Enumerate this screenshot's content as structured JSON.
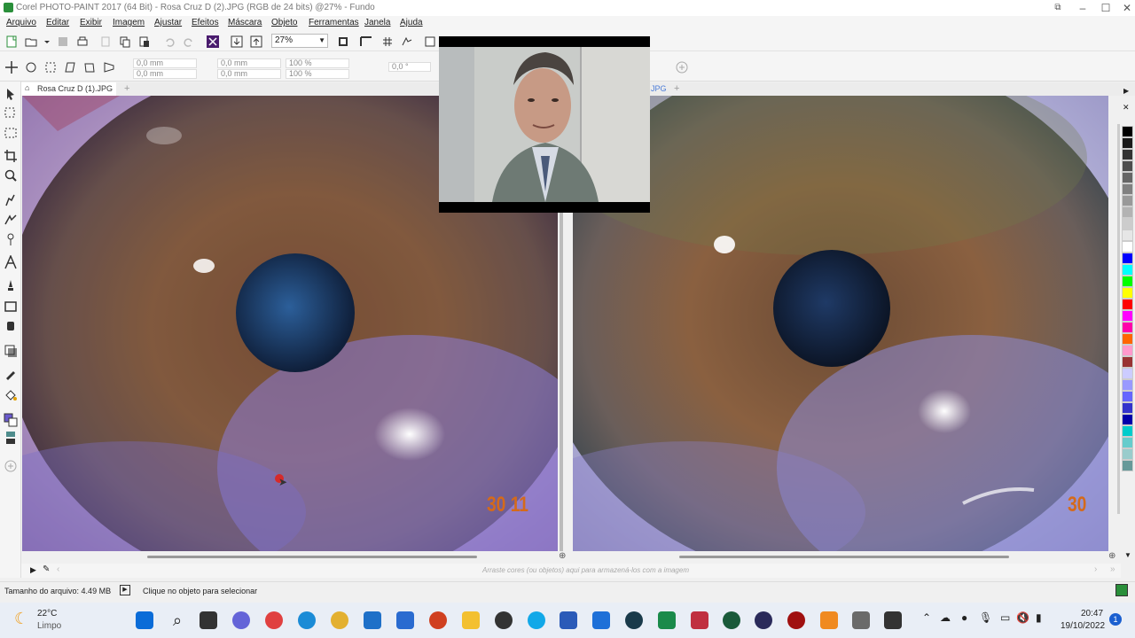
{
  "window": {
    "title": "Corel PHOTO-PAINT 2017 (64 Bit) - Rosa Cruz D (2).JPG (RGB de 24 bits) @27% - Fundo",
    "controls": [
      "–",
      "☐",
      "✕"
    ]
  },
  "menu": [
    "Arquivo",
    "Editar",
    "Exibir",
    "Imagem",
    "Ajustar",
    "Efeitos",
    "Máscara",
    "Objeto",
    "Ferramentas",
    "Janela",
    "Ajuda"
  ],
  "toolbar": {
    "zoom": "27%"
  },
  "propbar": {
    "pos_x": "0,0 mm",
    "pos_y": "0,0 mm",
    "size_w": "0,0 mm",
    "size_h": "0,0 mm",
    "scale_w": "100 %",
    "scale_h": "100 %",
    "angle": "0,0 °"
  },
  "tabs": {
    "left": "Rosa Cruz D (1).JPG",
    "right_partial": "JPG"
  },
  "canvas": {
    "left_date": "30  11",
    "right_date": "30"
  },
  "palette_hint": "Arraste cores (ou objetos) aqui para armazená-los com a imagem",
  "status": {
    "file_size": "Tamanho do arquivo: 4.49 MB",
    "hint": "Clique no objeto para selecionar"
  },
  "taskbar": {
    "temp": "22°C",
    "weather": "Limpo",
    "time": "20:47",
    "date": "19/10/2022",
    "notifications": "1"
  },
  "palette_colors": [
    "#000000",
    "#1a1a1a",
    "#333333",
    "#4d4d4d",
    "#666666",
    "#808080",
    "#999999",
    "#b3b3b3",
    "#cccccc",
    "#e6e6e6",
    "#ffffff",
    "#0000ff",
    "#00ffff",
    "#00ff00",
    "#ffff00",
    "#ff0000",
    "#ff00ff",
    "#ff00aa",
    "#ff6600",
    "#ff99cc",
    "#993333",
    "#ccccff",
    "#9999ff",
    "#6666ff",
    "#3333cc",
    "#0000aa",
    "#00cccc",
    "#66cccc",
    "#99cccc",
    "#669999"
  ]
}
